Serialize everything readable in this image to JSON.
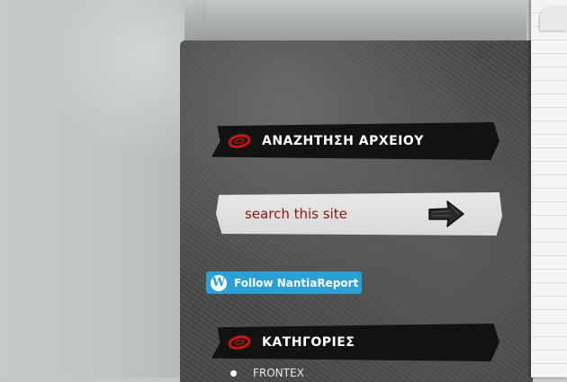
{
  "sidebar": {
    "search_widget": {
      "title": "ΑΝΑΖΗΤΗΣΗ ΑΡΧΕΙΟΥ",
      "placeholder": "search this site",
      "value": ""
    },
    "follow_button": {
      "label": "Follow NantiaReport",
      "icon": "wordpress-icon"
    },
    "categories_widget": {
      "title": "ΚΑΤΗΓΟΡΙΕΣ",
      "items": [
        {
          "label": "FRONTEX"
        }
      ]
    }
  },
  "colors": {
    "accent_red": "#8b1414",
    "follow_blue": "#2aa0d4",
    "title_bar": "#121212"
  }
}
